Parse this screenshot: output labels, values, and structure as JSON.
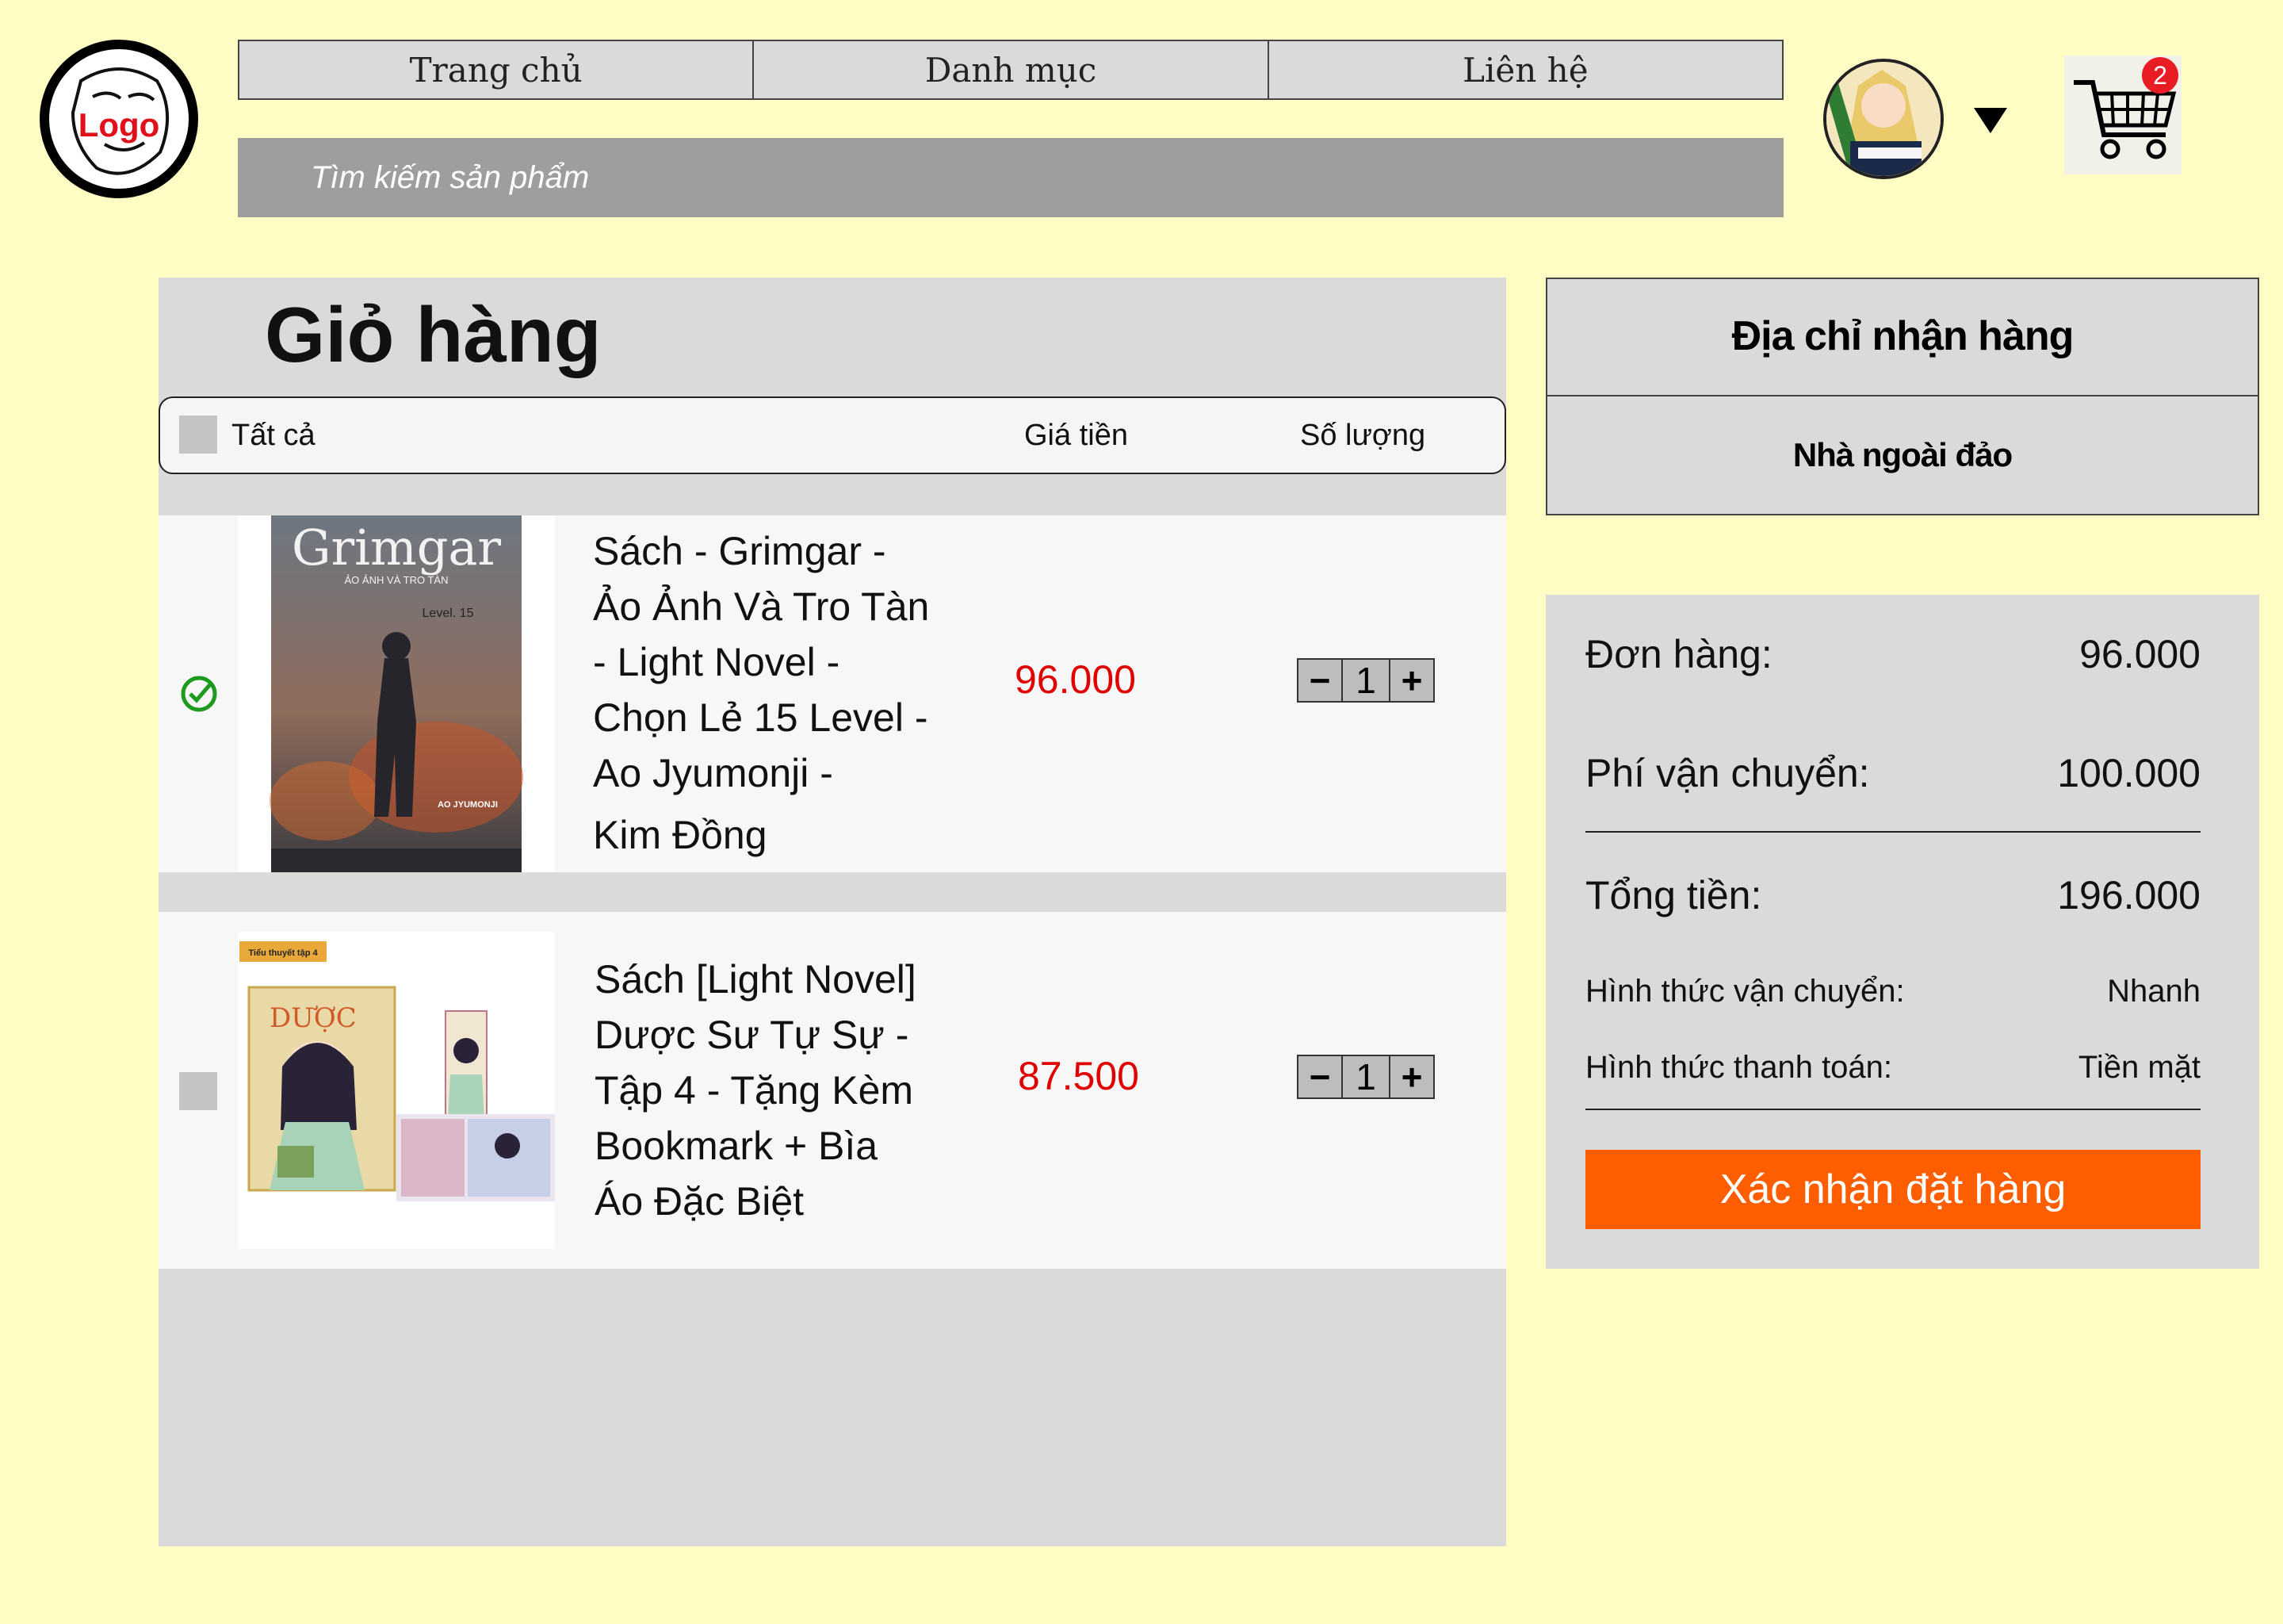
{
  "logo": {
    "text": "Logo"
  },
  "nav": {
    "items": [
      {
        "label": "Trang chủ"
      },
      {
        "label": "Danh mục"
      },
      {
        "label": "Liên hệ"
      }
    ]
  },
  "search": {
    "placeholder": "Tìm kiếm sản phẩm",
    "value": ""
  },
  "cart": {
    "badge_count": "2"
  },
  "cart_page": {
    "title": "Giỏ hàng",
    "header": {
      "select_all": "Tất cả",
      "price": "Giá tiền",
      "quantity": "Số lượng"
    },
    "items": [
      {
        "checked": true,
        "name_lines": [
          "Sách - Grimgar -",
          "Ảo Ảnh Và Tro Tàn",
          "- Light Novel -",
          "Chọn Lẻ 15 Level -",
          "Ao Jyumonji -",
          "Kim Đồng"
        ],
        "price": "96.000",
        "quantity": "1",
        "cover_title": "Grimgar",
        "cover_subtitle": "ẢO ẢNH VÀ TRO TÀN",
        "cover_level": "Level. 15",
        "cover_author": "AO JYUMONJI"
      },
      {
        "checked": false,
        "name_lines": [
          "Sách [Light Novel]",
          "Dược Sư Tự Sự -",
          "Tập 4 - Tặng Kèm",
          "Bookmark + Bìa",
          "Áo Đặc Biệt"
        ],
        "price": "87.500",
        "quantity": "1",
        "cover_tag": "Tiểu thuyết tập 4"
      }
    ]
  },
  "address": {
    "title": "Địa chỉ nhận hàng",
    "value": "Nhà ngoài đảo"
  },
  "summary": {
    "order_label": "Đơn hàng:",
    "order_value": "96.000",
    "shipping_label": "Phí vận chuyển:",
    "shipping_value": "100.000",
    "total_label": "Tổng tiền:",
    "total_value": "196.000",
    "ship_method_label": "Hình thức vận chuyển:",
    "ship_method_value": "Nhanh",
    "payment_label": "Hình thức thanh toán:",
    "payment_value": "Tiền mặt",
    "confirm_label": "Xác nhận đặt hàng"
  },
  "colors": {
    "background": "#FFFDC3",
    "panel": "#DADADA",
    "price": "#E00000",
    "confirm": "#FF5E00",
    "badge": "#E81C24",
    "check": "#1E9A1E"
  }
}
